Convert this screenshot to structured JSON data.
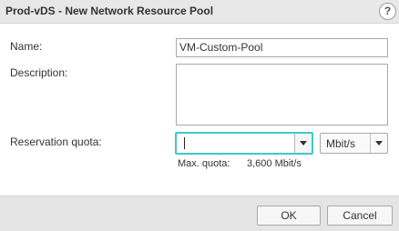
{
  "dialog": {
    "title": "Prod-vDS - New Network Resource Pool",
    "help_glyph": "?"
  },
  "form": {
    "name_label": "Name:",
    "name_value": "VM-Custom-Pool",
    "description_label": "Description:",
    "description_value": "",
    "reservation_label": "Reservation quota:",
    "reservation_value": "",
    "unit_selected": "Mbit/s",
    "max_quota_label": "Max. quota:",
    "max_quota_value": "3,600 Mbit/s"
  },
  "buttons": {
    "ok": "OK",
    "cancel": "Cancel"
  },
  "colors": {
    "focus_border": "#3fc8c8",
    "titlebar_bg": "#e8e8e8",
    "footer_bg": "#e5e5e5"
  },
  "icons": {
    "help": "help-icon",
    "dropdown": "chevron-down-icon"
  }
}
